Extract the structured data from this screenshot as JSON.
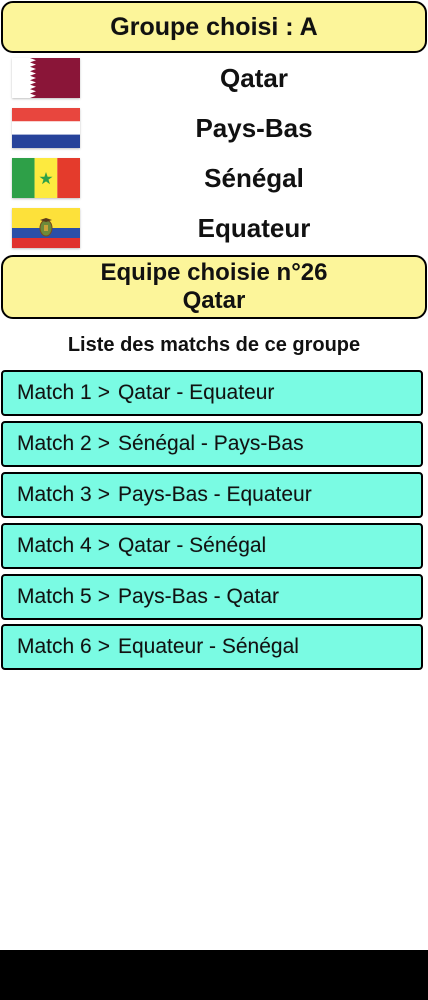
{
  "header": {
    "label": "Groupe choisi :  A"
  },
  "teams": [
    {
      "name": "Qatar",
      "flag_icon": "qatar-flag-icon"
    },
    {
      "name": "Pays-Bas",
      "flag_icon": "netherlands-flag-icon"
    },
    {
      "name": "Sénégal",
      "flag_icon": "senegal-flag-icon"
    },
    {
      "name": "Equateur",
      "flag_icon": "ecuador-flag-icon"
    }
  ],
  "chosen": {
    "line1": "Equipe choisie n°26",
    "line2": "Qatar"
  },
  "list_title": "Liste des matchs de ce groupe",
  "matches": [
    {
      "label": "Match 1",
      "sep": ">",
      "teams": "Qatar - Equateur"
    },
    {
      "label": "Match 2",
      "sep": ">",
      "teams": "Sénégal - Pays-Bas"
    },
    {
      "label": "Match 3",
      "sep": ">",
      "teams": "Pays-Bas - Equateur"
    },
    {
      "label": "Match 4",
      "sep": ">",
      "teams": "Qatar - Sénégal"
    },
    {
      "label": "Match 5",
      "sep": ">",
      "teams": "Pays-Bas - Qatar"
    },
    {
      "label": "Match 6",
      "sep": ">",
      "teams": "Equateur - Sénégal"
    }
  ],
  "colors": {
    "header_bg": "#fcf59a",
    "match_bg": "#7afbe3",
    "border": "#000000"
  }
}
